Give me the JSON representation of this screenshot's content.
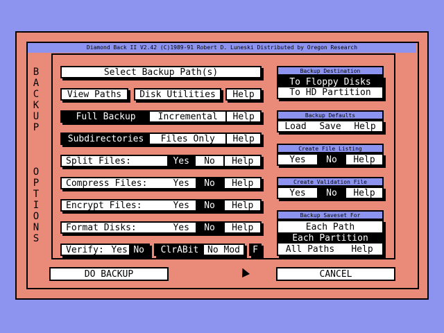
{
  "app": {
    "title": "Diamond Back II V2.42  (C)1989-91 Robert D. Luneski   Distributed by Oregon Research"
  },
  "side": {
    "backup": [
      "B",
      "A",
      "C",
      "K",
      "U",
      "P"
    ],
    "options": [
      "O",
      "P",
      "T",
      "I",
      "O",
      "N",
      "S"
    ]
  },
  "left": {
    "select_path": "Select Backup Path(s)",
    "view_paths": "View Paths",
    "disk_utilities": "Disk Utilities",
    "help": "Help",
    "full_backup": "Full Backup",
    "incremental": "Incremental",
    "subdirectories": "Subdirectories",
    "files_only": "Files Only",
    "split_files": "Split Files:",
    "compress_files": "Compress Files:",
    "encrypt_files": "Encrypt Files:",
    "format_disks": "Format Disks:",
    "yes": "Yes",
    "no": "No",
    "verify": "Verify:",
    "clrabit": "ClrABit",
    "no_mod": "No Mod",
    "f": "F"
  },
  "right": {
    "dest_header": "Backup Destination",
    "to_floppy": "To Floppy Disks",
    "to_hd": "To HD Partition",
    "defaults_header": "Backup Defaults",
    "load": "Load",
    "save": "Save",
    "help": "Help",
    "listing_header": "Create File Listing",
    "validation_header": "Create Validation File",
    "yes": "Yes",
    "no": "No",
    "saveset_header": "Backup Saveset For",
    "each_path": "Each Path",
    "each_partition": "Each Partition",
    "all_paths": "All Paths"
  },
  "actions": {
    "do_backup": "DO BACKUP",
    "cancel": "CANCEL"
  },
  "colors": {
    "background": "#8c94f0",
    "frame": "#ea8a78",
    "selected": "#000000",
    "box": "#ffffff"
  }
}
